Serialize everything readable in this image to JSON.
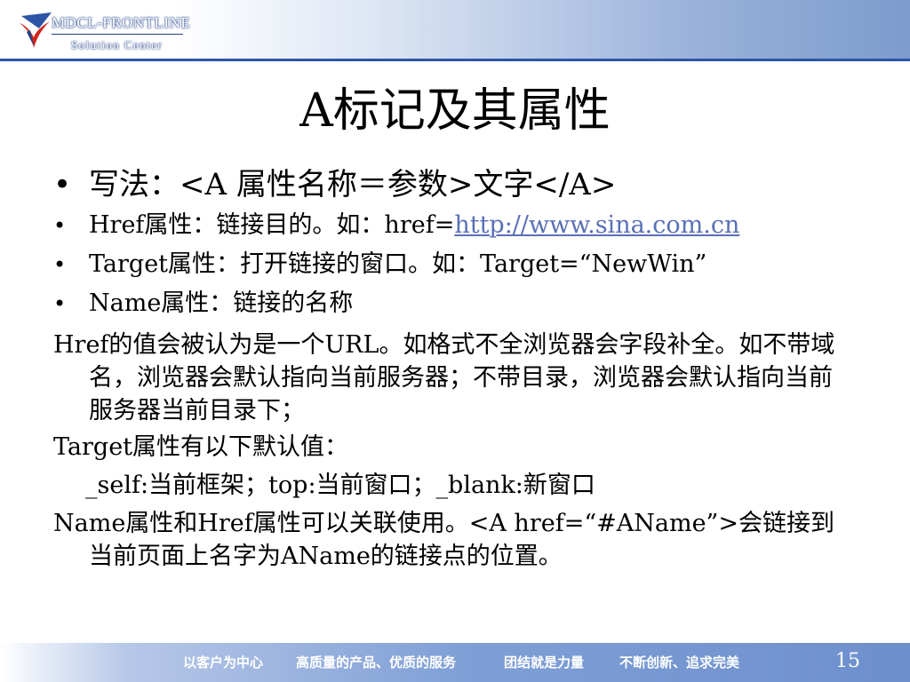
{
  "brand": {
    "name": "MDCL-FRONTLINE",
    "subtitle": "Solution Center"
  },
  "slide": {
    "title": "A标记及其属性",
    "bullets": [
      {
        "text": "写法：<A 属性名称＝参数>文字</A>"
      },
      {
        "text": "Href属性：链接目的。如：href=",
        "link": "http://www.sina.com.cn"
      },
      {
        "text": "Target属性：打开链接的窗口。如：Target=“NewWin”"
      },
      {
        "text": "Name属性：链接的名称"
      }
    ],
    "paragraphs": {
      "href_note": "Href的值会被认为是一个URL。如格式不全浏览器会字段补全。如不带域名，浏览器会默认指向当前服务器；不带目录，浏览器会默认指向当前服务器当前目录下；",
      "target_heading": "Target属性有以下默认值：",
      "target_values": "_self:当前框架；top:当前窗口；_blank:新窗口",
      "name_note": "Name属性和Href属性可以关联使用。<A href=“#AName”>会链接到当前页面上名字为AName的链接点的位置。"
    }
  },
  "footer": {
    "slogans": [
      "以客户为中心",
      "高质量的产品、优质的服务",
      "团结就是力量",
      "不断创新、追求完美"
    ],
    "page_number": "15"
  },
  "colors": {
    "header_blue": "#2d55a5",
    "logo_red": "#d0241c",
    "link": "#5a6fb6",
    "footer_blue": "#6d8fcc"
  }
}
